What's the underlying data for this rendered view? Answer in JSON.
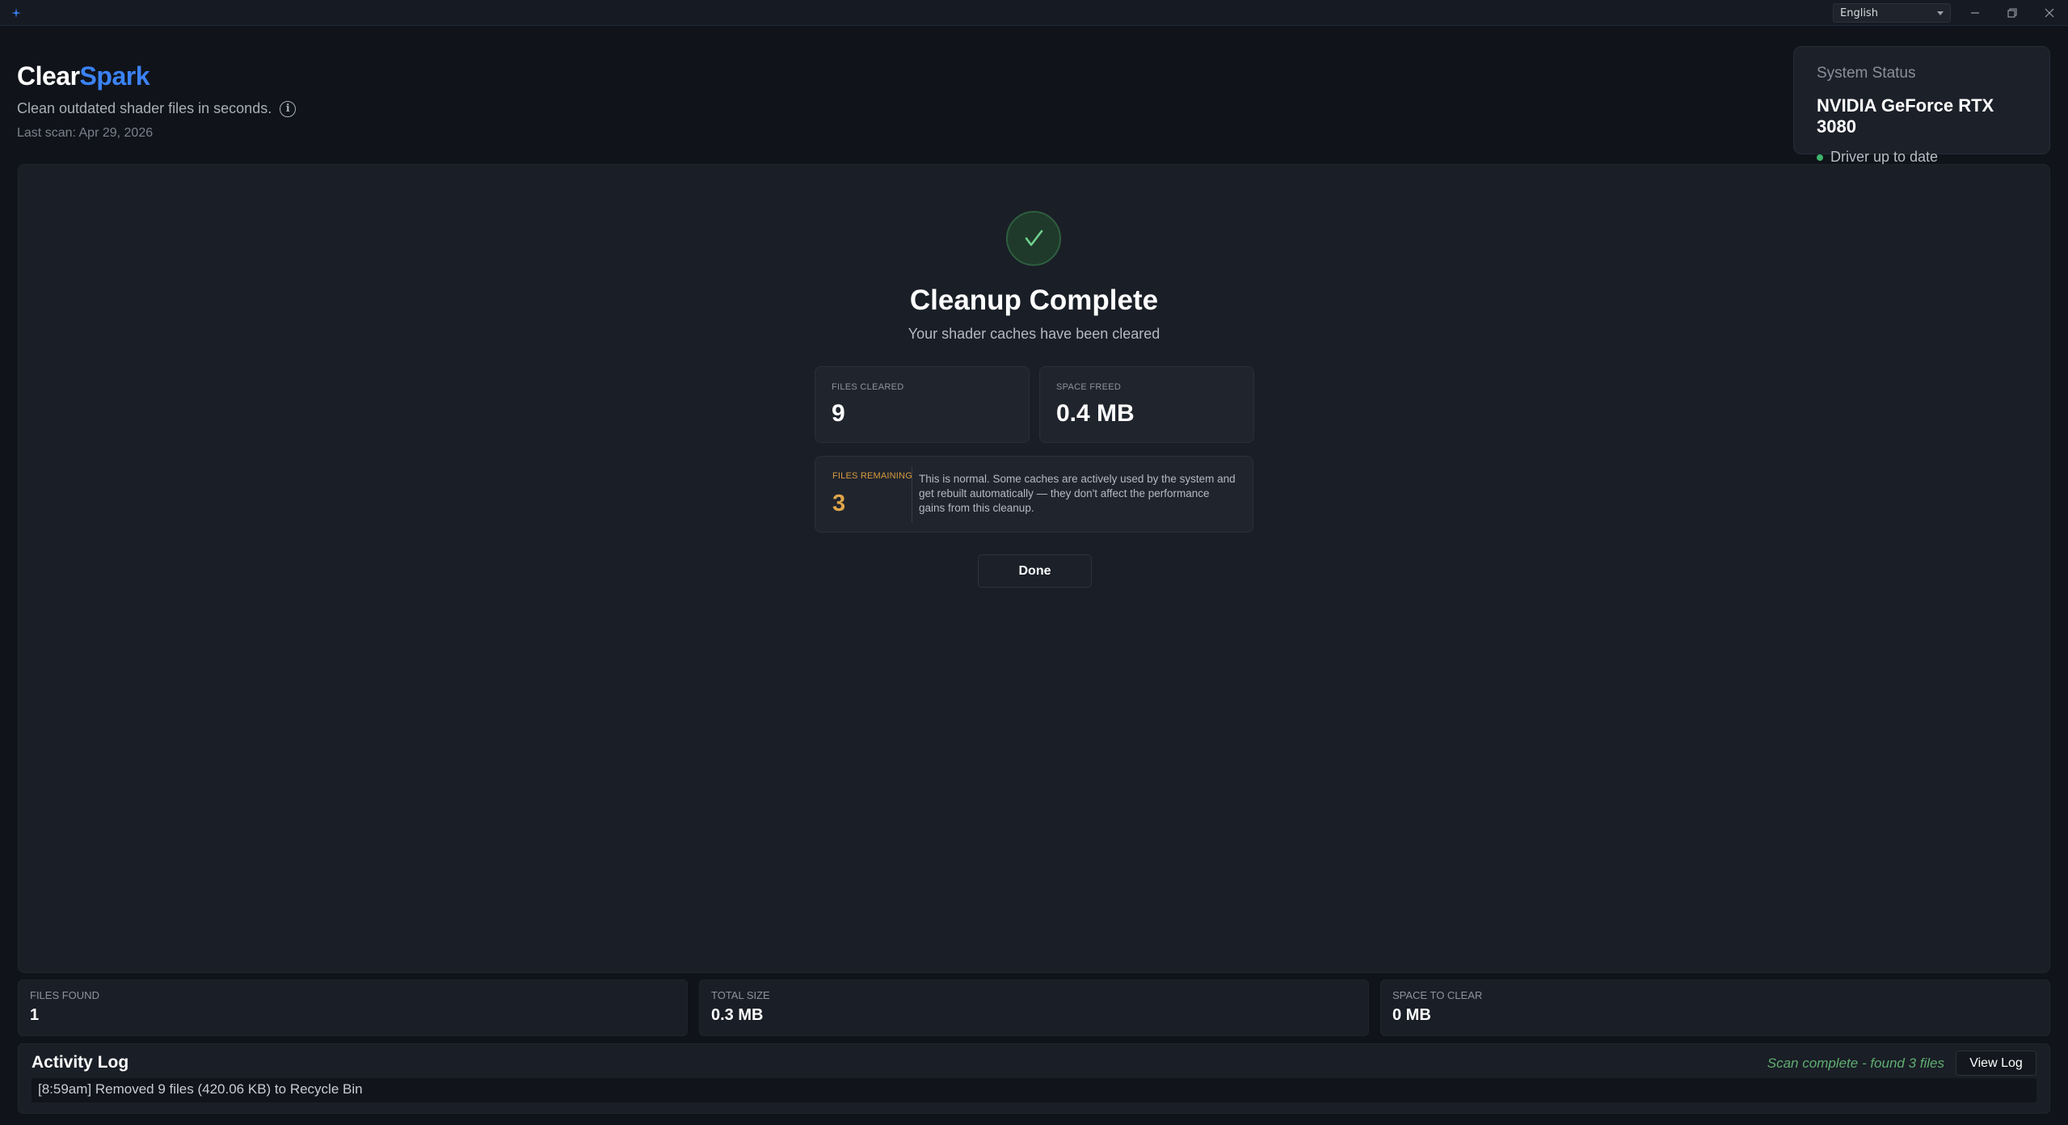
{
  "window": {
    "language": "English"
  },
  "header": {
    "brand_part1": "Clear",
    "brand_part2": "Spark",
    "tagline": "Clean outdated shader files in seconds.",
    "last_scan": "Last scan: Apr 29, 2026"
  },
  "system_status": {
    "label": "System Status",
    "gpu": "NVIDIA GeForce RTX 3080",
    "driver": "Driver up to date"
  },
  "result": {
    "title": "Cleanup Complete",
    "subtitle": "Your shader caches have been cleared",
    "files_cleared_label": "FILES CLEARED",
    "files_cleared": "9",
    "space_freed_label": "SPACE FREED",
    "space_freed": "0.4 MB",
    "files_remaining_label": "FILES REMAINING",
    "files_remaining": "3",
    "remaining_note": "This is normal. Some caches are actively used by the system and get rebuilt automatically — they don't affect the performance gains from this cleanup.",
    "done_label": "Done"
  },
  "stats": {
    "files_found_label": "FILES FOUND",
    "files_found": "1",
    "total_size_label": "TOTAL SIZE",
    "total_size": "0.3 MB",
    "space_to_clear_label": "SPACE TO CLEAR",
    "space_to_clear": "0 MB"
  },
  "activity": {
    "title": "Activity Log",
    "scan_status": "Scan complete - found 3 files",
    "view_log_label": "View Log",
    "entries": [
      "[8:59am] Removed 9 files (420.06 KB) to Recycle Bin"
    ]
  },
  "colors": {
    "accent": "#3b82f6",
    "success": "#3fb36b",
    "warning": "#e0a54a",
    "background": "#10131a"
  }
}
